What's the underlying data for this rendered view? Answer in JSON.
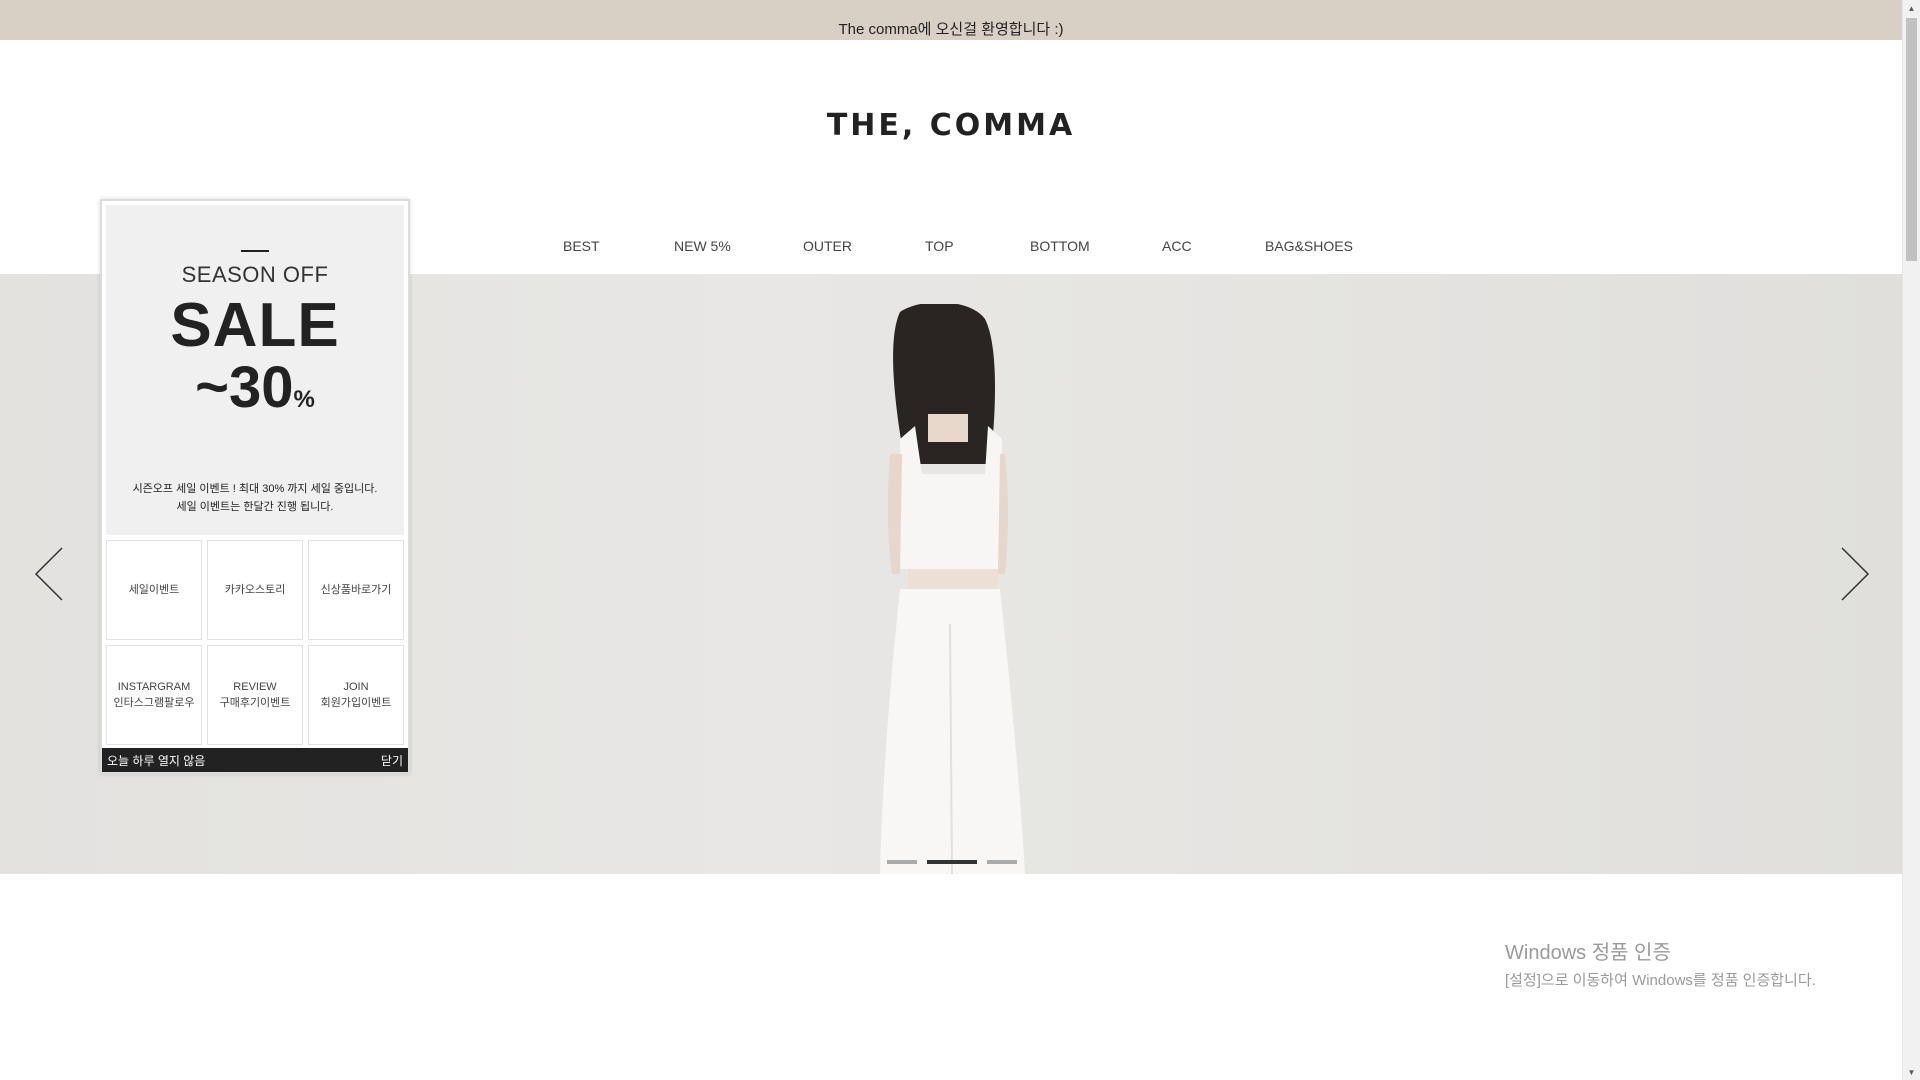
{
  "topbar": {
    "text": "The comma에 오신걸 환영합니다 :)"
  },
  "header": {
    "logo": "THE, COMMA"
  },
  "nav": {
    "items": [
      {
        "label": "BEST"
      },
      {
        "label": "NEW 5%"
      },
      {
        "label": "OUTER"
      },
      {
        "label": "TOP"
      },
      {
        "label": "BOTTOM"
      },
      {
        "label": "ACC"
      },
      {
        "label": "BAG&SHOES"
      }
    ]
  },
  "hero": {
    "icons": {
      "prev": "chevron-left-icon",
      "next": "chevron-right-icon"
    },
    "slides_total": 3,
    "active_slide": 2
  },
  "popup": {
    "season": "SEASON OFF",
    "sale": "SALE",
    "percent_value": "~30",
    "percent_sign": "%",
    "desc_line1": "시즌오프 세일 이벤트 ! 최대 30% 까지 세일 중입니다.",
    "desc_line2": "세일 이벤트는 한달간 진행 됩니다.",
    "cells": [
      {
        "line1": "세일이벤트",
        "line2": ""
      },
      {
        "line1": "카카오스토리",
        "line2": ""
      },
      {
        "line1": "신상품바로가기",
        "line2": ""
      },
      {
        "line1": "INSTARGRAM",
        "line2": "인타스그램팔로우"
      },
      {
        "line1": "REVIEW",
        "line2": "구매후기이벤트"
      },
      {
        "line1": "JOIN",
        "line2": "회원가입이벤트"
      }
    ],
    "dont_show_today": "오늘 하루 열지 않음",
    "close": "닫기"
  },
  "watermark": {
    "title": "Windows 정품 인증",
    "subtitle": "[설정]으로 이동하여 Windows를 정품 인증합니다."
  },
  "colors": {
    "topbar_bg": "#d8cfc5",
    "hero_bg": "#e6e5e2",
    "popup_footer_bg": "#222222"
  }
}
